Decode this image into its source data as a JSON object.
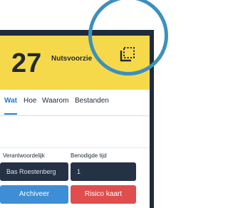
{
  "header": {
    "number": "27",
    "title": "Nutsvoorzie",
    "copy_icon": "copy-icon",
    "background": "#f6d94a"
  },
  "tabs": [
    {
      "label": "Wat",
      "active": true
    },
    {
      "label": "Hoe"
    },
    {
      "label": "Waarom"
    },
    {
      "label": "Bestanden"
    }
  ],
  "form": {
    "responsible_label": "Verantwoordelijk",
    "responsible_value": "Bas Roestenberg",
    "time_label": "Benodigde tijd",
    "time_value": "1"
  },
  "actions": {
    "archive_label": "Archiveer",
    "risk_label": "Risico kaart",
    "archive_color": "#3e8ed6",
    "risk_color": "#e04d4d"
  },
  "accent": "#2979c9",
  "highlight_color": "#3d8fbe"
}
